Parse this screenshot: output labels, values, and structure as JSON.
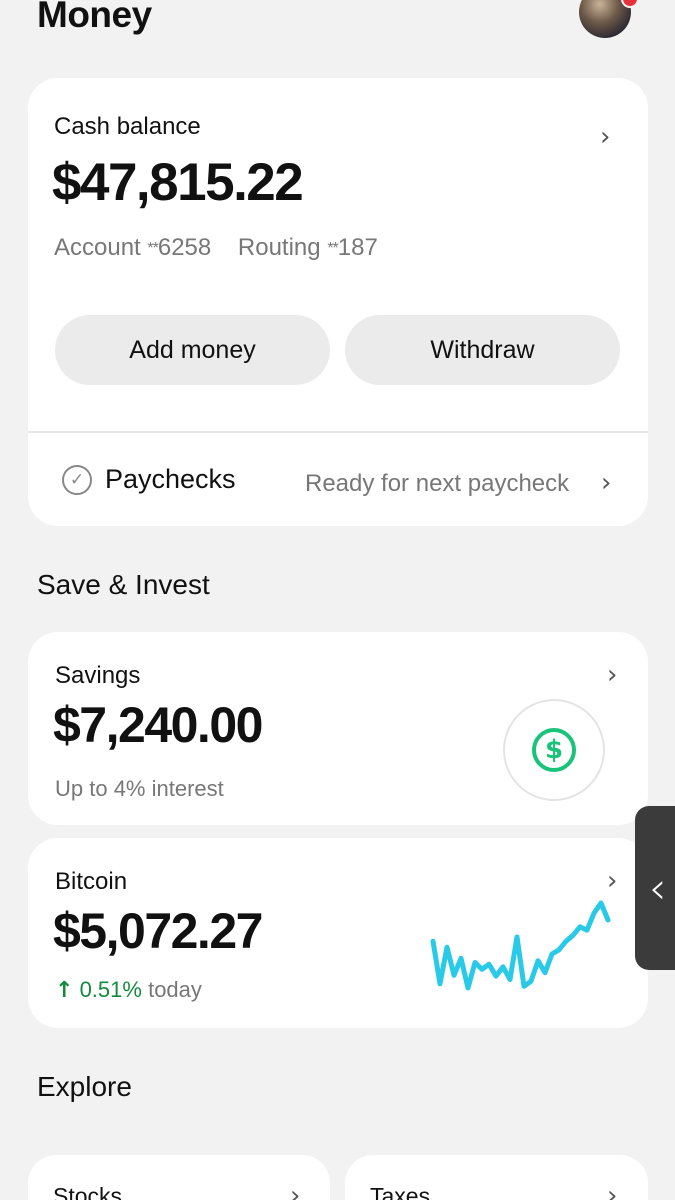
{
  "header": {
    "title": "Money"
  },
  "cash": {
    "label": "Cash balance",
    "amount": "$47,815.22",
    "account_label": "Account",
    "account_mask": "**",
    "account_digits": "6258",
    "routing_label": "Routing",
    "routing_mask": "**",
    "routing_digits": "187",
    "add_money_label": "Add money",
    "withdraw_label": "Withdraw",
    "paychecks_label": "Paychecks",
    "paychecks_status": "Ready for next paycheck"
  },
  "save_invest": {
    "title": "Save & Invest",
    "savings": {
      "label": "Savings",
      "amount": "$7,240.00",
      "sub": "Up to 4% interest"
    },
    "bitcoin": {
      "label": "Bitcoin",
      "amount": "$5,072.27",
      "change": "0.51%",
      "change_suffix": "today",
      "sparkline_color": "#29c9e8",
      "sparkline": [
        0.55,
        0.05,
        0.48,
        0.15,
        0.35,
        0.0,
        0.3,
        0.22,
        0.28,
        0.14,
        0.25,
        0.1,
        0.6,
        0.02,
        0.08,
        0.32,
        0.18,
        0.4,
        0.45,
        0.55,
        0.62,
        0.72,
        0.68,
        0.88,
        1.0,
        0.8
      ]
    }
  },
  "explore": {
    "title": "Explore",
    "tiles": [
      {
        "label": "Stocks"
      },
      {
        "label": "Taxes"
      }
    ]
  },
  "icons": {
    "chevron": "chevron-right-icon",
    "check": "check-circle-icon",
    "savings": "dollar-circle-icon",
    "gain": "arrow-up-icon",
    "side_tab": "chevron-left-icon"
  },
  "colors": {
    "accent": "#19c37a",
    "gain": "#148a3c",
    "background": "#f2f2f2"
  }
}
